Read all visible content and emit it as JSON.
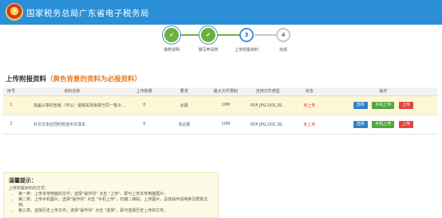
{
  "header": {
    "title": "国家税务总局广东省电子税务局"
  },
  "steps": [
    {
      "label": "填表说明",
      "state": "done",
      "symbol": "✔"
    },
    {
      "label": "填写申请表",
      "state": "done",
      "symbol": "✔"
    },
    {
      "label": "上传附报资料",
      "state": "current",
      "symbol": "3"
    },
    {
      "label": "完成",
      "state": "todo",
      "symbol": "4"
    }
  ],
  "section": {
    "title": "上传附报资料",
    "note": "（黄色背景的资料为必报资料）"
  },
  "table": {
    "headers": [
      "序号",
      "资料名称",
      "上传数量",
      "要求",
      "最大文件限制",
      "支持文件类型",
      "状态",
      "操作"
    ],
    "rows": [
      {
        "index": "1",
        "name": "加盖公章的省级（市以）或相关改易变已同一笔令...",
        "count": "0",
        "requirement": "必报",
        "max_size": "10M",
        "types": "PDF,JPG,DOC,四...",
        "status": "未上传",
        "required": true
      },
      {
        "index": "2",
        "name": "外文文本应同时附送中文译本",
        "count": "0",
        "requirement": "非必报",
        "max_size": "10M",
        "types": "PDF,JPG,DOC,四...",
        "status": "未上传",
        "required": false
      }
    ],
    "actions": {
      "select": "选择",
      "mobile": "手机上传",
      "upload": "上传"
    }
  },
  "tips": {
    "title": "温馨提示：",
    "subtitle": "上传附报资料的方式：",
    "items": [
      "第一类：上传本地电脑的文件；选择\"操作列\" 点击 \"上传\"，即可上传本地电脑图片;",
      "第二类：上传手机图片；选择\"操作列\" 点击 \"手机上传\"，扫描二维码，上传图片，具体操作说明参见帮助文档;",
      "第三类，选择历史上传文件；选择\"操作列\" 点击 \"选择\"，即可选择历史上传的文件。"
    ]
  },
  "colors": {
    "header": "#2a8fd6",
    "done": "#6bb33d",
    "required_row": "#fdf7d6",
    "status_text": "#e03a2e"
  }
}
